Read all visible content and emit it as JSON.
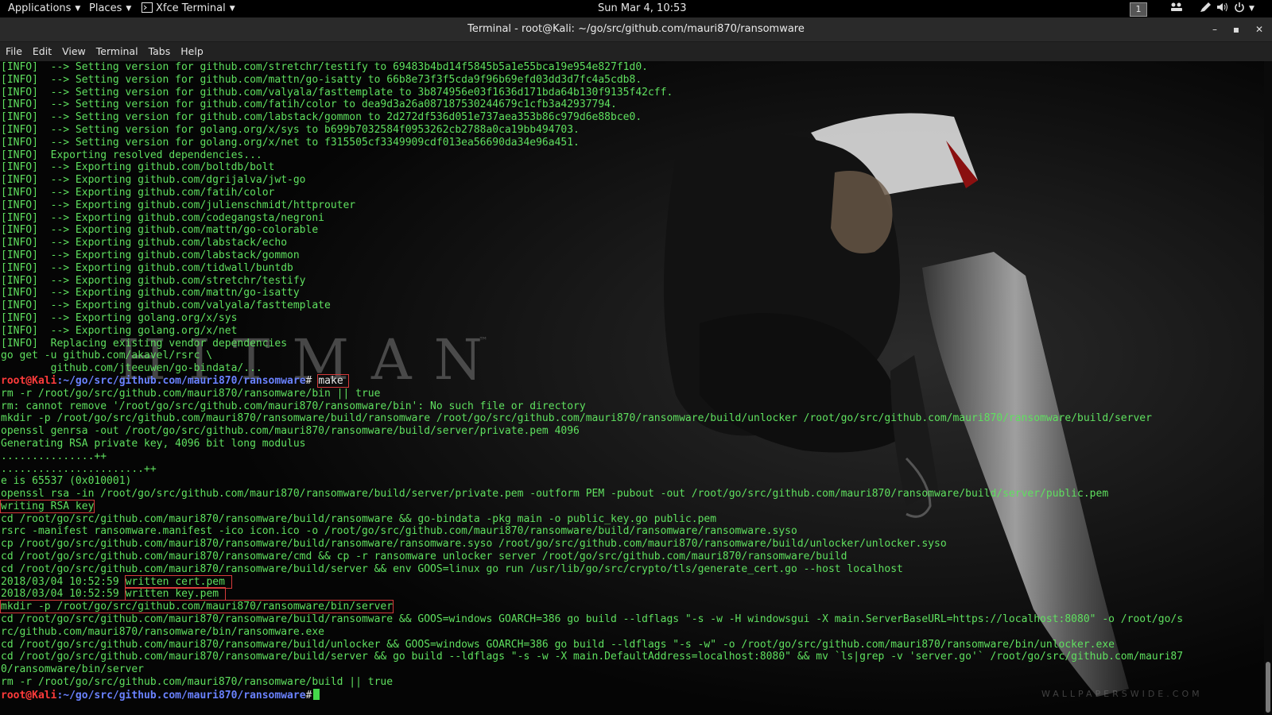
{
  "topbar": {
    "applications": "Applications",
    "places": "Places",
    "terminal_app": "Xfce Terminal",
    "clock": "Sun Mar  4, 10:53",
    "workspace": "1"
  },
  "window": {
    "title": "Terminal - root@Kali: ~/go/src/github.com/mauri870/ransomware"
  },
  "menu": [
    "File",
    "Edit",
    "View",
    "Terminal",
    "Tabs",
    "Help"
  ],
  "prompt": {
    "user": "root@Kali",
    "path": ":~/go/src/github.com/mauri870/ransomware",
    "symbol": "#",
    "command": "make"
  },
  "wallpaper": {
    "title": "HITMAN",
    "trademark": "™",
    "watermark": "WALLPAPERSWIDE.COM"
  },
  "output_before": [
    "[INFO]  --> Setting version for github.com/stretchr/testify to 69483b4bd14f5845b5a1e55bca19e954e827f1d0.",
    "[INFO]  --> Setting version for github.com/mattn/go-isatty to 66b8e73f3f5cda9f96b69efd03dd3d7fc4a5cdb8.",
    "[INFO]  --> Setting version for github.com/valyala/fasttemplate to 3b874956e03f1636d171bda64b130f9135f42cff.",
    "[INFO]  --> Setting version for github.com/fatih/color to dea9d3a26a087187530244679c1cfb3a42937794.",
    "[INFO]  --> Setting version for github.com/labstack/gommon to 2d272df536d051e737aea353b86c979d6e88bce0.",
    "[INFO]  --> Setting version for golang.org/x/sys to b699b7032584f0953262cb2788a0ca19bb494703.",
    "[INFO]  --> Setting version for golang.org/x/net to f315505cf3349909cdf013ea56690da34e96a451.",
    "[INFO]  Exporting resolved dependencies...",
    "[INFO]  --> Exporting github.com/boltdb/bolt",
    "[INFO]  --> Exporting github.com/dgrijalva/jwt-go",
    "[INFO]  --> Exporting github.com/fatih/color",
    "[INFO]  --> Exporting github.com/julienschmidt/httprouter",
    "[INFO]  --> Exporting github.com/codegangsta/negroni",
    "[INFO]  --> Exporting github.com/mattn/go-colorable",
    "[INFO]  --> Exporting github.com/labstack/echo",
    "[INFO]  --> Exporting github.com/labstack/gommon",
    "[INFO]  --> Exporting github.com/tidwall/buntdb",
    "[INFO]  --> Exporting github.com/stretchr/testify",
    "[INFO]  --> Exporting github.com/mattn/go-isatty",
    "[INFO]  --> Exporting github.com/valyala/fasttemplate",
    "[INFO]  --> Exporting golang.org/x/sys",
    "[INFO]  --> Exporting golang.org/x/net",
    "[INFO]  Replacing existing vendor dependencies",
    "go get -u github.com/akavel/rsrc \\",
    "        github.com/jteeuwen/go-bindata/..."
  ],
  "output_after": [
    "rm -r /root/go/src/github.com/mauri870/ransomware/bin || true",
    "rm: cannot remove '/root/go/src/github.com/mauri870/ransomware/bin': No such file or directory",
    "mkdir -p /root/go/src/github.com/mauri870/ransomware/build/ransomware /root/go/src/github.com/mauri870/ransomware/build/unlocker /root/go/src/github.com/mauri870/ransomware/build/server",
    "openssl genrsa -out /root/go/src/github.com/mauri870/ransomware/build/server/private.pem 4096",
    "Generating RSA private key, 4096 bit long modulus",
    "...............++",
    ".......................++",
    "e is 65537 (0x010001)",
    "openssl rsa -in /root/go/src/github.com/mauri870/ransomware/build/server/private.pem -outform PEM -pubout -out /root/go/src/github.com/mauri870/ransomware/build/server/public.pem",
    "writing RSA key",
    "cd /root/go/src/github.com/mauri870/ransomware/build/ransomware && go-bindata -pkg main -o public_key.go public.pem",
    "rsrc -manifest ransomware.manifest -ico icon.ico -o /root/go/src/github.com/mauri870/ransomware/build/ransomware/ransomware.syso",
    "cp /root/go/src/github.com/mauri870/ransomware/build/ransomware/ransomware.syso /root/go/src/github.com/mauri870/ransomware/build/unlocker/unlocker.syso",
    "cd /root/go/src/github.com/mauri870/ransomware/cmd && cp -r ransomware unlocker server /root/go/src/github.com/mauri870/ransomware/build",
    "cd /root/go/src/github.com/mauri870/ransomware/build/server && env GOOS=linux go run /usr/lib/go/src/crypto/tls/generate_cert.go --host localhost"
  ],
  "cert_lines": [
    {
      "ts": "2018/03/04 10:52:59",
      "msg": "written cert.pem"
    },
    {
      "ts": "2018/03/04 10:52:59",
      "msg": "written key.pem"
    }
  ],
  "mkdir_line": "mkdir -p /root/go/src/github.com/mauri870/ransomware/bin/server",
  "output_build": [
    "cd /root/go/src/github.com/mauri870/ransomware/build/ransomware && GOOS=windows GOARCH=386 go build --ldflags \"-s -w -H windowsgui -X main.ServerBaseURL=https://localhost:8080\" -o /root/go/s",
    "rc/github.com/mauri870/ransomware/bin/ransomware.exe",
    "cd /root/go/src/github.com/mauri870/ransomware/build/unlocker && GOOS=windows GOARCH=386 go build --ldflags \"-s -w\" -o /root/go/src/github.com/mauri870/ransomware/bin/unlocker.exe",
    "cd /root/go/src/github.com/mauri870/ransomware/build/server && go build --ldflags \"-s -w -X main.DefaultAddress=localhost:8080\" && mv `ls|grep -v 'server.go'` /root/go/src/github.com/mauri87",
    "0/ransomware/bin/server",
    "rm -r /root/go/src/github.com/mauri870/ransomware/build || true"
  ],
  "colors": {
    "terminal_bg": "#050505",
    "terminal_text": "#5fe05f",
    "prompt_user": "#ff3b3b",
    "prompt_path": "#6a82ff",
    "highlight_box": "#d63a3a"
  }
}
